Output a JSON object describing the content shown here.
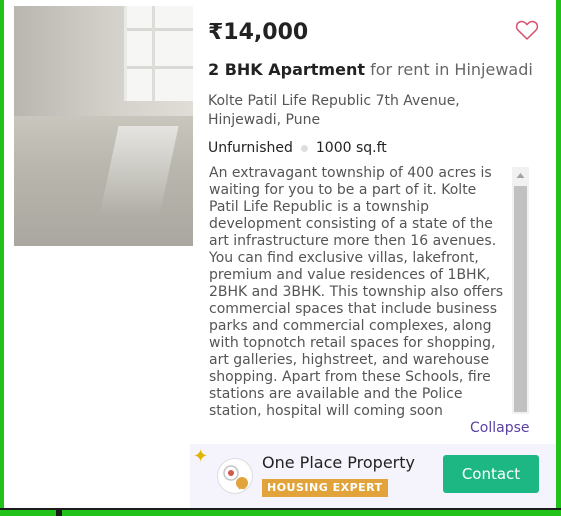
{
  "listing": {
    "price": "₹14,000",
    "title_bold": "2 BHK Apartment",
    "title_rest": " for rent in Hinjewadi",
    "address": "Kolte Patil Life Republic 7th Avenue, Hinjewadi, Pune",
    "furnishing": "Unfurnished",
    "area": "1000 sq.ft",
    "description": "An extravagant township of 400 acres is waiting for you to be a part of it. Kolte Patil Life Republic is a township development consisting of a state of the art infrastructure more then 16 avenues. You can find exclusive villas, lakefront, premium and value residences of 1BHK, 2BHK and 3BHK. This township also offers commercial spaces that include business parks and commercial complexes, along with topnotch retail spaces for shopping, art galleries, highstreet, and warehouse shopping. Apart from these Schools, fire stations are available and the Police station, hospital will coming soon",
    "collapse_label": "Collapse"
  },
  "agent": {
    "name": "One Place Property",
    "badge": "HOUSING EXPERT",
    "contact_label": "Contact"
  },
  "colors": {
    "frame": "#22c21a",
    "contact_button": "#1cb783",
    "expert_badge": "#e2a43a",
    "collapse_link": "#5a3fa5",
    "heart": "#d4526e"
  },
  "icons": {
    "favorite": "heart-outline-icon",
    "sparkle": "sparkle-icon",
    "expert": "expert-badge-icon",
    "scroll_up": "scroll-up-arrow-icon"
  }
}
